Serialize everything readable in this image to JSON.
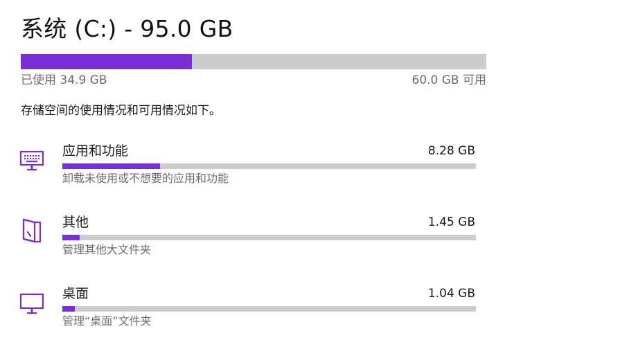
{
  "drive": {
    "title": "系统 (C:) - 95.0 GB",
    "used_label": "已使用 34.9 GB",
    "free_label": "60.0 GB 可用",
    "used_fraction": 0.367
  },
  "description": "存储空间的使用情况和可用情况如下。",
  "colors": {
    "accent": "#7a2ed6",
    "bar_track": "#cccccc",
    "secondary_text": "#6b6b6b"
  },
  "categories": [
    {
      "icon": "keyboard-icon",
      "name": "应用和功能",
      "size": "8.28 GB",
      "subtitle": "卸载未使用或不想要的应用和功能",
      "fraction": 0.237
    },
    {
      "icon": "folder-icon",
      "name": "其他",
      "size": "1.45 GB",
      "subtitle": "管理其他大文件夹",
      "fraction": 0.042
    },
    {
      "icon": "monitor-icon",
      "name": "桌面",
      "size": "1.04 GB",
      "subtitle": "管理“桌面”文件夹",
      "fraction": 0.03
    }
  ]
}
